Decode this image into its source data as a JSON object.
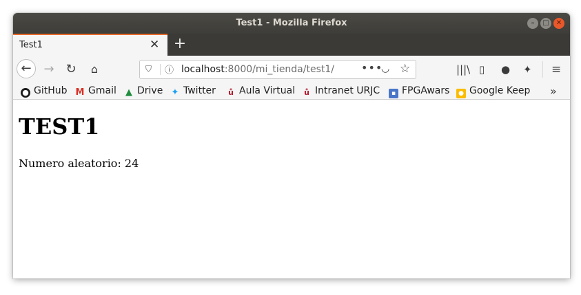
{
  "window": {
    "title": "Test1 - Mozilla Firefox"
  },
  "tabs": [
    {
      "label": "Test1"
    }
  ],
  "addressbar": {
    "host": "localhost",
    "path": ":8000/mi_tienda/test1/"
  },
  "bookmarks": [
    {
      "label": "GitHub",
      "icon": "github-icon"
    },
    {
      "label": "Gmail",
      "icon": "gmail-icon"
    },
    {
      "label": "Drive",
      "icon": "drive-icon"
    },
    {
      "label": "Twitter",
      "icon": "twitter-icon"
    },
    {
      "label": "Aula Virtual",
      "icon": "urjc-icon"
    },
    {
      "label": "Intranet URJC",
      "icon": "urjc-icon"
    },
    {
      "label": "FPGAwars",
      "icon": "fpgawars-icon"
    },
    {
      "label": "Google Keep",
      "icon": "keep-icon"
    }
  ],
  "page": {
    "heading": "TEST1",
    "text": "Numero aleatorio: 24"
  }
}
